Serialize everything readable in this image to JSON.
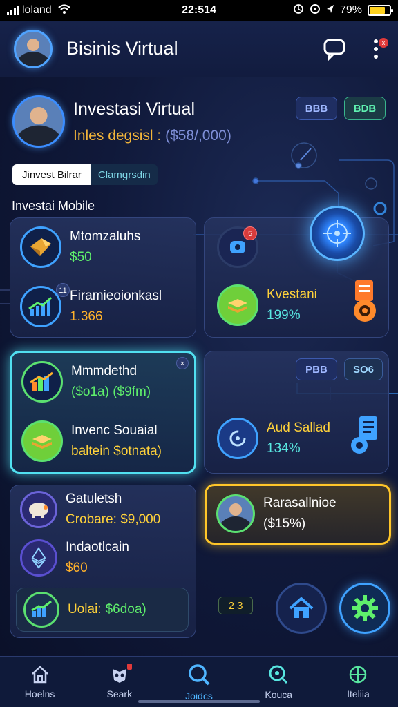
{
  "status_bar": {
    "carrier": "loland",
    "time": "22:514",
    "battery": "79%",
    "battery_level": 0.79
  },
  "header": {
    "title": "Bisinis Virtual",
    "menu_badge": "x"
  },
  "profile": {
    "name": "Investasi Virtual",
    "balance_label": "Inles degsisl :",
    "balance_value": "($58/,000)",
    "pill_blue": "BBB",
    "pill_green": "BDB"
  },
  "tabs": {
    "active": "Jinvest Bilrar",
    "other": "Clamgrsdin"
  },
  "section_label": "Investai Mobile",
  "cards": {
    "card1": {
      "row1_title": "Mtomzaluhs",
      "row1_value": "$50",
      "row2_title": "Firamieoionkasl",
      "row2_value": "1.366",
      "row2_badge": "11"
    },
    "card2": {
      "badge": "5",
      "title": "Kvestani",
      "value": "199%"
    },
    "card3": {
      "row1_title": "Mmmdethd",
      "row1_value": "($o1a) ($9fm)",
      "row2_title": "Invenc Souaial",
      "row2_value": "baltein $otnata)",
      "close": "×"
    },
    "card4": {
      "pill1": "PBB",
      "pill2": "SO6",
      "title": "Aud Sallad",
      "value": "134%"
    },
    "card5": {
      "row1_title": "Gatuletsh",
      "row1_value": "Crobare: $9,000",
      "row2_title": "Indaotlcain",
      "row2_value": "$60",
      "total_label": "Uolai:",
      "total_value": "$6doa)"
    },
    "card6": {
      "title": "Rarasallnioe",
      "value": "($15%)"
    }
  },
  "counter_chip": "2 3",
  "bottom_nav": [
    {
      "label": "Hoelns",
      "icon": "home-icon",
      "active": false
    },
    {
      "label": "Seark",
      "icon": "mask-icon",
      "active": false
    },
    {
      "label": "Joidcs",
      "icon": "search-icon",
      "active": true
    },
    {
      "label": "Kouca",
      "icon": "magnify-icon",
      "active": false
    },
    {
      "label": "Iteliia",
      "icon": "globe-icon",
      "active": false
    }
  ],
  "colors": {
    "accent_blue": "#4fb5ff",
    "accent_green": "#5ff06c",
    "accent_gold": "#ffc629",
    "accent_cyan": "#51e0f0",
    "background": "#10193a"
  }
}
